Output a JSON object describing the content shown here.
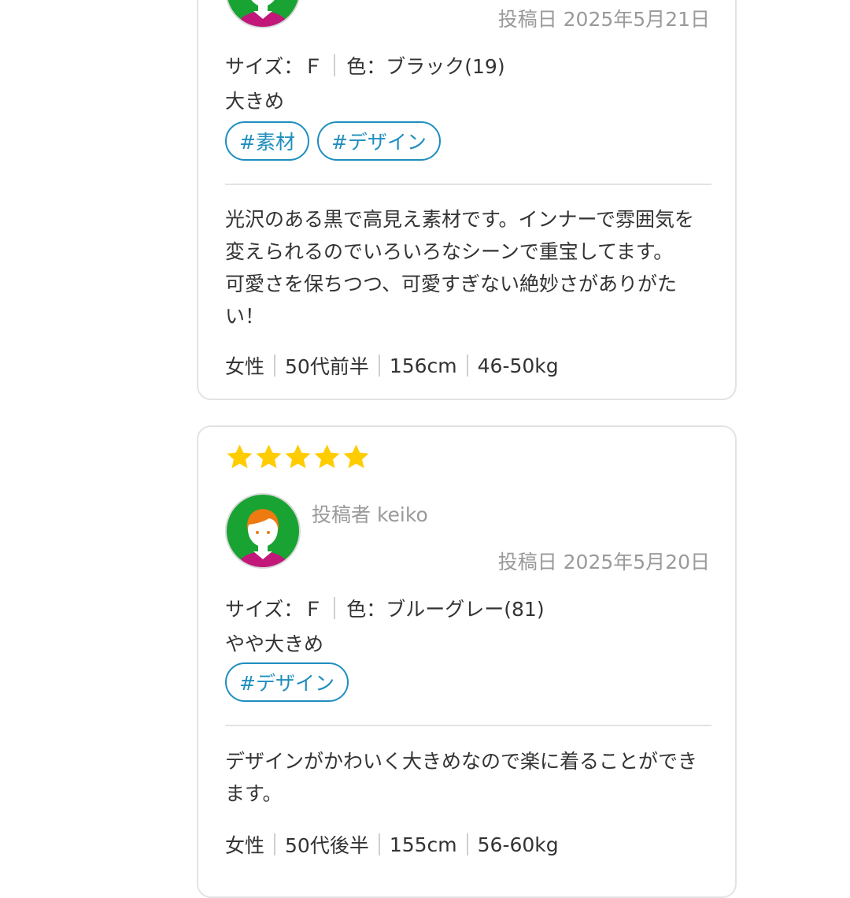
{
  "colors": {
    "tag_blue": "#1e8ebf",
    "star_gold": "#ffcc00",
    "avatar_green": "#19a332",
    "avatar_magenta": "#c2187a",
    "hair_orange": "#ee7a12"
  },
  "reviews": [
    {
      "date": "投稿日 2025年5月21日",
      "size": "サイズ：Ｆ",
      "color": "色：ブラック(19)",
      "fit": "大きめ",
      "tags": [
        "#素材",
        "#デザイン"
      ],
      "body": [
        "光沢のある黒で高見え素材です。インナーで雰囲気を",
        "変えられるのでいろいろなシーンで重宝してます。",
        "可愛さを保ちつつ、可愛すぎない絶妙さがありがた",
        "い！"
      ],
      "profile": [
        "女性",
        "50代前半",
        "156cm",
        "46-50kg"
      ]
    },
    {
      "rating": 5,
      "poster": "投稿者 keiko",
      "date": "投稿日 2025年5月20日",
      "size": "サイズ：Ｆ",
      "color": "色：ブルーグレー(81)",
      "fit": "やや大きめ",
      "tags": [
        "#デザイン"
      ],
      "body": [
        "デザインがかわいく大きめなので楽に着ることができ",
        "ます。"
      ],
      "profile": [
        "女性",
        "50代後半",
        "155cm",
        "56-60kg"
      ]
    }
  ]
}
